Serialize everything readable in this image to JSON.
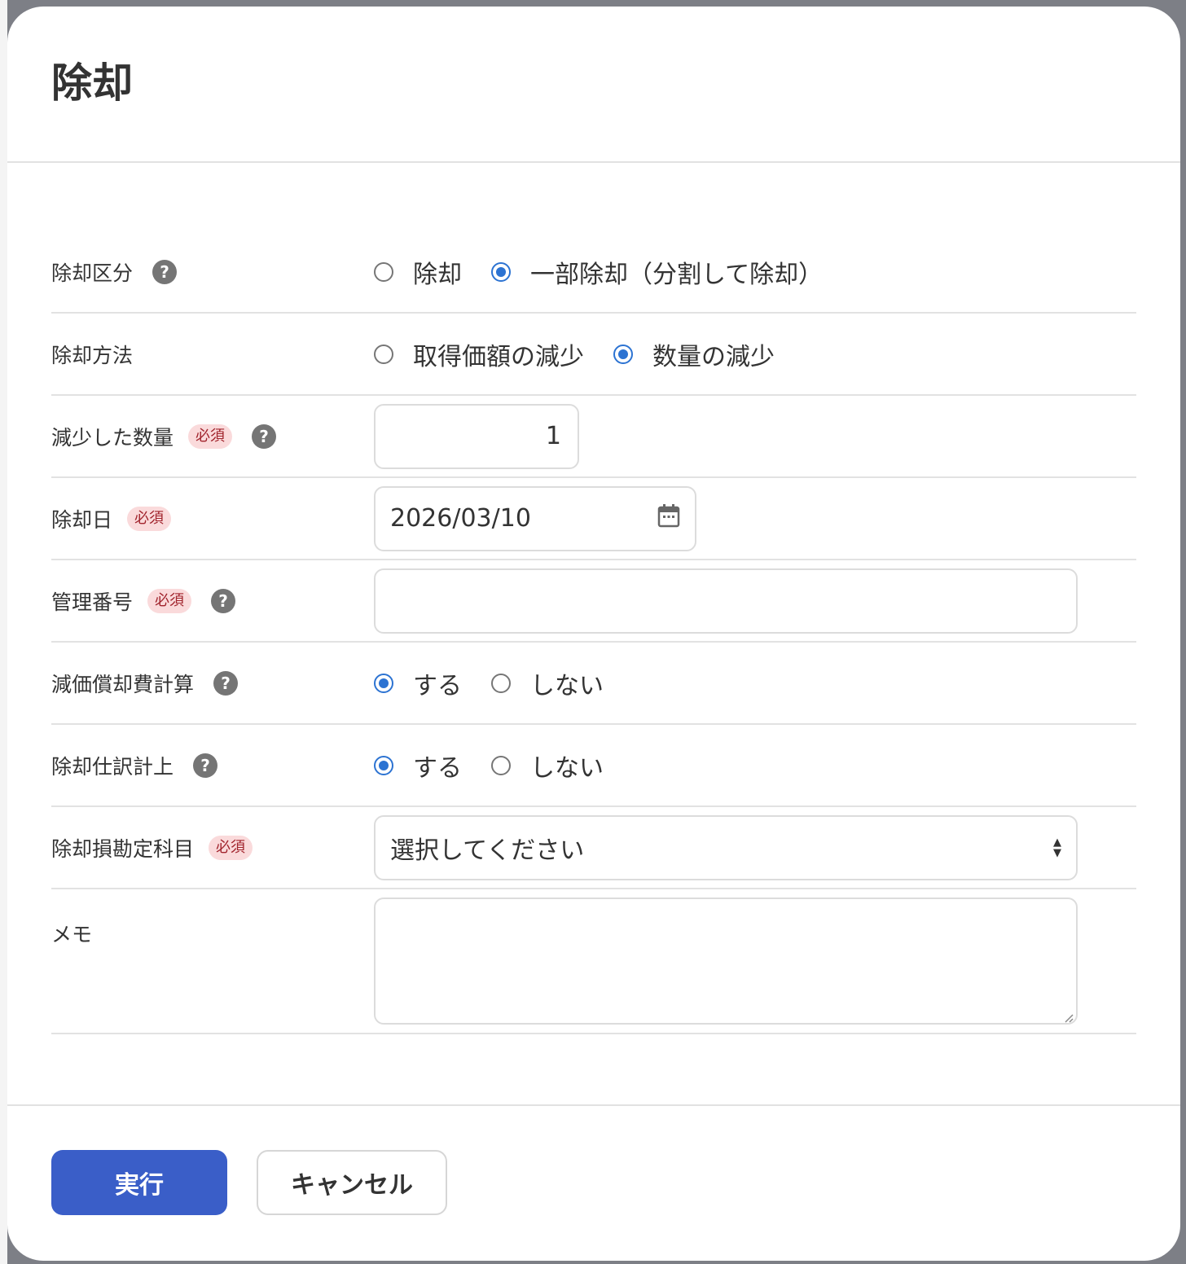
{
  "dialog": {
    "title": "除却"
  },
  "form": {
    "disposal_type": {
      "label": "除却区分",
      "options": [
        {
          "label": "除却",
          "checked": false
        },
        {
          "label": "一部除却（分割して除却）",
          "checked": true
        }
      ]
    },
    "disposal_method": {
      "label": "除却方法",
      "options": [
        {
          "label": "取得価額の減少",
          "checked": false
        },
        {
          "label": "数量の減少",
          "checked": true
        }
      ]
    },
    "reduced_quantity": {
      "label": "減少した数量",
      "required_badge": "必須",
      "value": "1"
    },
    "disposal_date": {
      "label": "除却日",
      "required_badge": "必須",
      "value": "2026/03/10"
    },
    "management_number": {
      "label": "管理番号",
      "required_badge": "必須",
      "value": ""
    },
    "depreciation_calc": {
      "label": "減価償却費計算",
      "options": [
        {
          "label": "する",
          "checked": true
        },
        {
          "label": "しない",
          "checked": false
        }
      ]
    },
    "disposal_journal": {
      "label": "除却仕訳計上",
      "options": [
        {
          "label": "する",
          "checked": true
        },
        {
          "label": "しない",
          "checked": false
        }
      ]
    },
    "disposal_loss_account": {
      "label": "除却損勘定科目",
      "required_badge": "必須",
      "value": "選択してください"
    },
    "memo": {
      "label": "メモ",
      "value": ""
    }
  },
  "footer": {
    "execute_label": "実行",
    "cancel_label": "キャンセル"
  },
  "colors": {
    "accent": "#2c73d2",
    "primary_button": "#3a5ec8",
    "required_badge_bg": "#fadadb",
    "required_badge_text": "#a1242d"
  },
  "icons": {
    "help": "question-circle-icon",
    "calendar": "calendar-icon",
    "select": "select-arrows-icon"
  }
}
